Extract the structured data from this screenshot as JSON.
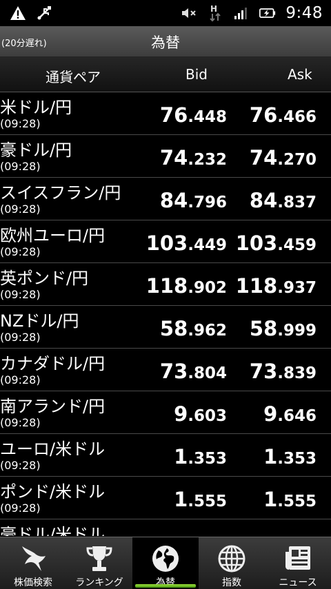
{
  "status_bar": {
    "time": "9:48",
    "icons_left": [
      "warning-icon",
      "usb-debug-icon"
    ],
    "icons_right": [
      "mute-icon",
      "hspa-data-icon",
      "signal-icon",
      "battery-charging-icon"
    ]
  },
  "title_bar": {
    "delay_note": "(20分遅れ)",
    "title": "為替"
  },
  "table_header": {
    "pair": "通貨ペア",
    "bid": "Bid",
    "ask": "Ask"
  },
  "rates": [
    {
      "pair": "米ドル/円",
      "time": "(09:28)",
      "bid_int": "76",
      "bid_dec": ".448",
      "ask_int": "76",
      "ask_dec": ".466"
    },
    {
      "pair": "豪ドル/円",
      "time": "(09:28)",
      "bid_int": "74",
      "bid_dec": ".232",
      "ask_int": "74",
      "ask_dec": ".270"
    },
    {
      "pair": "スイスフラン/円",
      "time": "(09:28)",
      "bid_int": "84",
      "bid_dec": ".796",
      "ask_int": "84",
      "ask_dec": ".837"
    },
    {
      "pair": "欧州ユーロ/円",
      "time": "(09:28)",
      "bid_int": "103",
      "bid_dec": ".449",
      "ask_int": "103",
      "ask_dec": ".459"
    },
    {
      "pair": "英ポンド/円",
      "time": "(09:28)",
      "bid_int": "118",
      "bid_dec": ".902",
      "ask_int": "118",
      "ask_dec": ".937"
    },
    {
      "pair": "NZドル/円",
      "time": "(09:28)",
      "bid_int": "58",
      "bid_dec": ".962",
      "ask_int": "58",
      "ask_dec": ".999"
    },
    {
      "pair": "カナダドル/円",
      "time": "(09:28)",
      "bid_int": "73",
      "bid_dec": ".804",
      "ask_int": "73",
      "ask_dec": ".839"
    },
    {
      "pair": "南アランド/円",
      "time": "(09:28)",
      "bid_int": "9",
      "bid_dec": ".603",
      "ask_int": "9",
      "ask_dec": ".646"
    },
    {
      "pair": "ユーロ/米ドル",
      "time": "(09:28)",
      "bid_int": "1",
      "bid_dec": ".353",
      "ask_int": "1",
      "ask_dec": ".353"
    },
    {
      "pair": "ポンド/米ドル",
      "time": "(09:28)",
      "bid_int": "1",
      "bid_dec": ".555",
      "ask_int": "1",
      "ask_dec": ".555"
    },
    {
      "pair": "豪ドル/米ドル",
      "time": "",
      "bid_int": "",
      "bid_dec": "",
      "ask_int": "",
      "ask_dec": ""
    }
  ],
  "bottom_nav": [
    {
      "label": "株価検索",
      "icon": "bird-icon",
      "active": false
    },
    {
      "label": "ランキング",
      "icon": "trophy-icon",
      "active": false
    },
    {
      "label": "為替",
      "icon": "globe-icon",
      "active": true
    },
    {
      "label": "指数",
      "icon": "grid-globe-icon",
      "active": false
    },
    {
      "label": "ニュース",
      "icon": "newspaper-icon",
      "active": false
    }
  ],
  "colors": {
    "active_indicator": "#6cc21f",
    "background": "#000000",
    "title_bar": "#4a4a4a"
  }
}
